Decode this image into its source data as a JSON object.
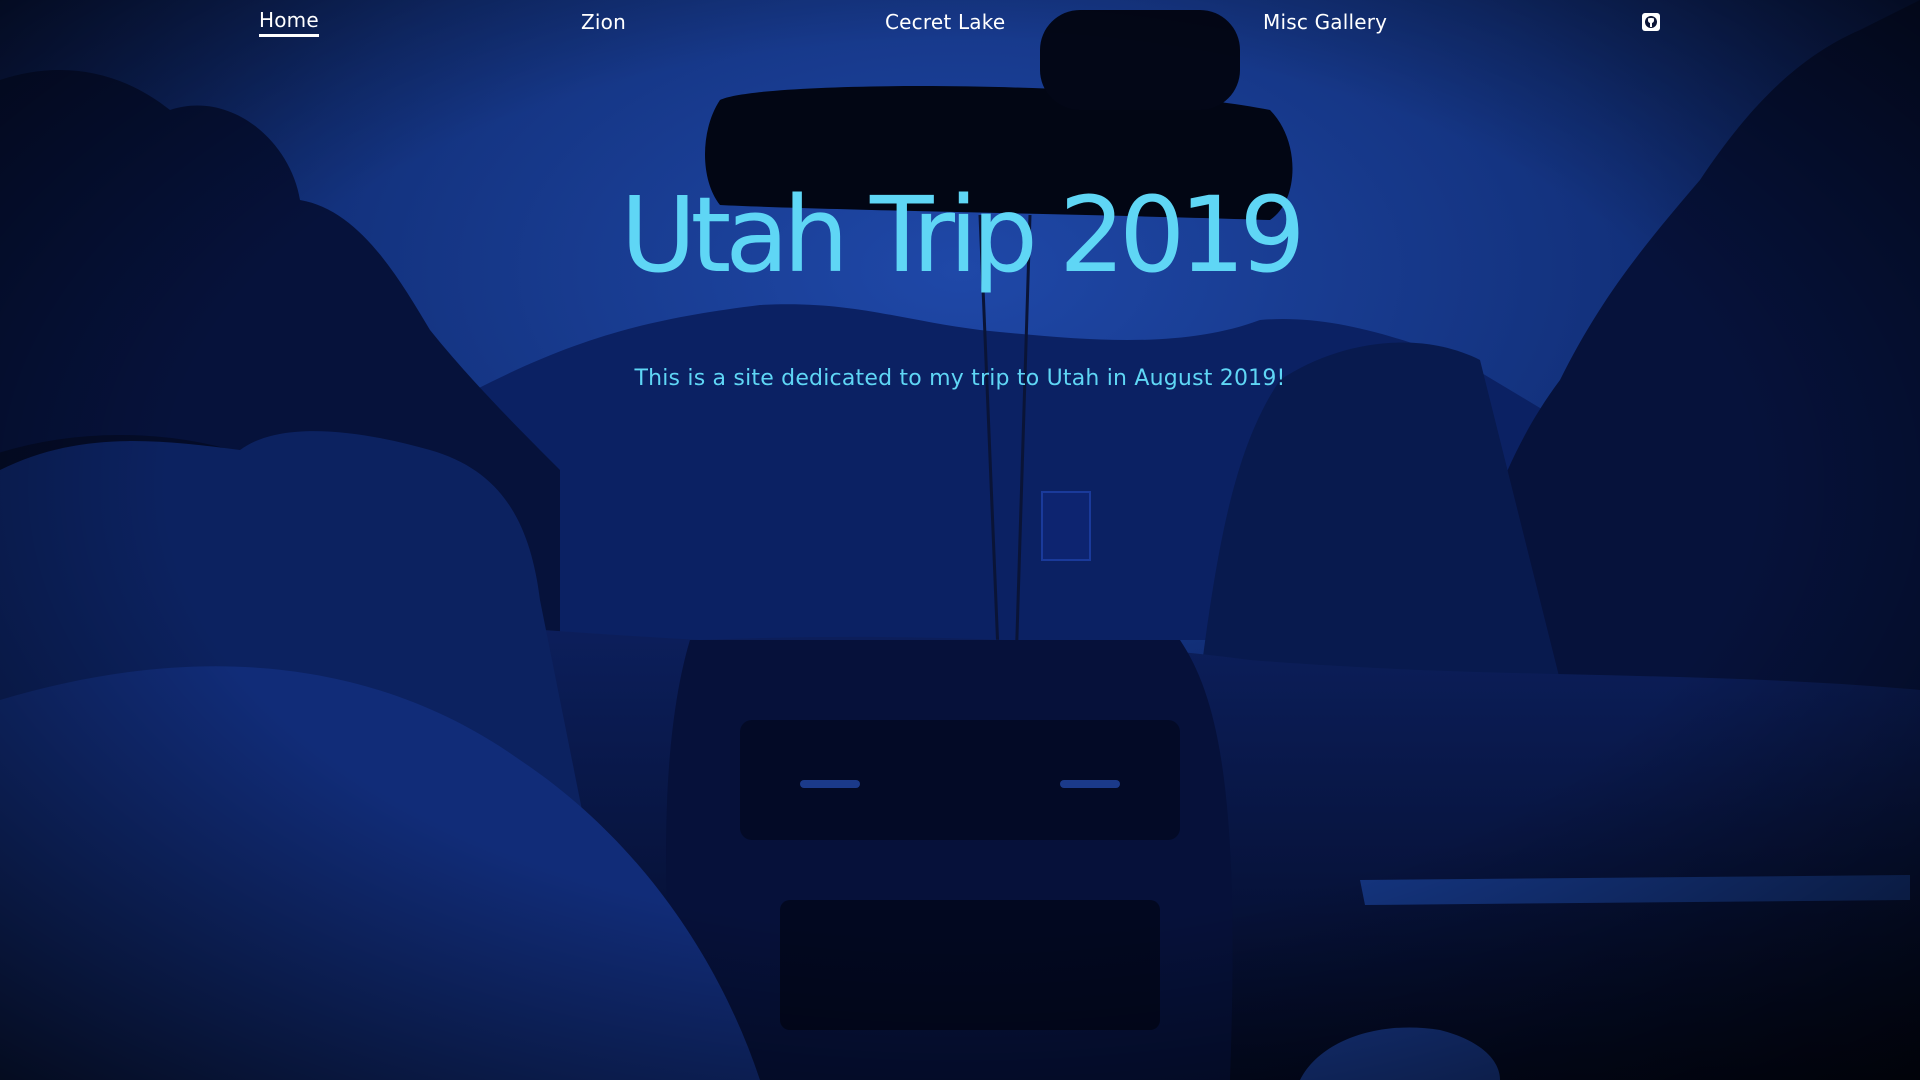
{
  "nav": {
    "items": [
      {
        "label": "Home",
        "active": true
      },
      {
        "label": "Zion",
        "active": false
      },
      {
        "label": "Cecret Lake",
        "active": false
      },
      {
        "label": "Misc Gallery",
        "active": false
      }
    ],
    "github_icon": "github-icon"
  },
  "hero": {
    "title": "Utah Trip 2019",
    "subtitle": "This is a site dedicated to my trip to Utah in August 2019!",
    "background_image": "car-dashboard-mountain-view-blue-tint"
  },
  "colors": {
    "accent": "#5fd6f5",
    "nav_text": "#ffffff",
    "overlay": "#0f2566"
  }
}
